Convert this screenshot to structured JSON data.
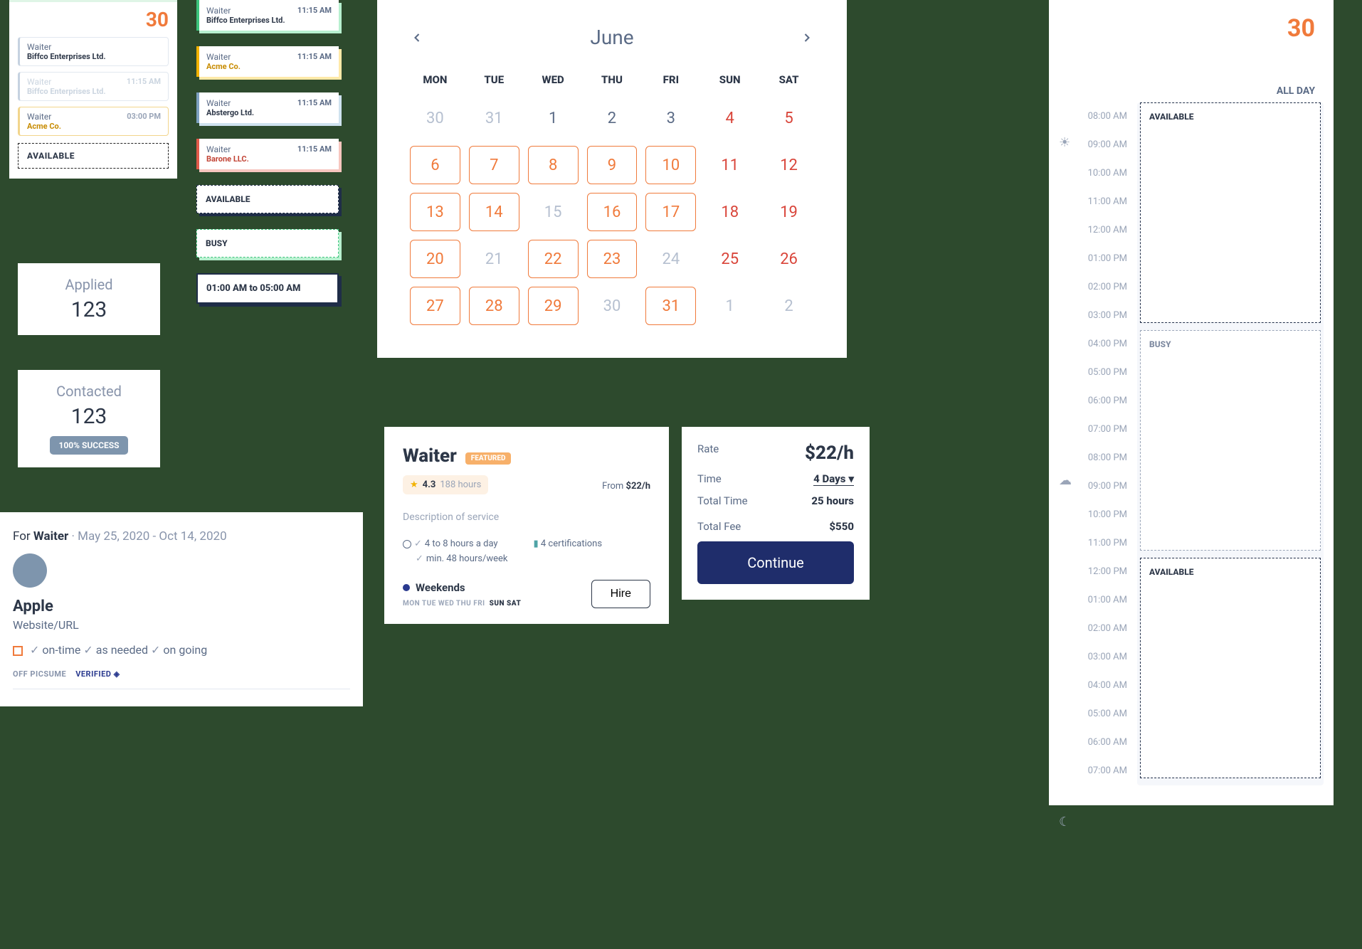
{
  "day30": {
    "num": "30",
    "slots": [
      {
        "role": "Waiter",
        "co": "Biffco Enterprises Ltd.",
        "time": ""
      },
      {
        "role": "Waiter",
        "co": "Biffco Enterprises Ltd.",
        "time": "11:15 AM"
      },
      {
        "role": "Waiter",
        "co": "Acme Co.",
        "time": "03:00 PM"
      }
    ],
    "avail": "AVAILABLE"
  },
  "slotcol": [
    {
      "role": "Waiter",
      "co": "Biffco Enterprises Ltd.",
      "time": "11:15 AM",
      "variant": "green"
    },
    {
      "role": "Waiter",
      "co": "Acme Co.",
      "time": "11:15 AM",
      "variant": "yellow"
    },
    {
      "role": "Waiter",
      "co": "Abstergo Ltd.",
      "time": "11:15 AM",
      "variant": "blue"
    },
    {
      "role": "Waiter",
      "co": "Barone LLC.",
      "time": "11:15 AM",
      "variant": "red"
    }
  ],
  "dash_available": "AVAILABLE",
  "dash_busy": "BUSY",
  "timebox": "01:00 AM to 05:00 AM",
  "kpi1": {
    "label": "Applied",
    "num": "123"
  },
  "kpi2": {
    "label": "Contacted",
    "num": "123",
    "badge": "100% SUCCESS"
  },
  "profile": {
    "for": "For ",
    "role": "Waiter",
    "sep": "   ·   ",
    "range": "May 25, 2020 - Oct 14, 2020",
    "name": "Apple",
    "url": "Website/URL",
    "tags": [
      "on-time",
      "as needed",
      "on going"
    ],
    "off": "OFF PICSUME",
    "ver": "VERIFIED"
  },
  "calendar": {
    "month": "June",
    "dow": [
      "MON",
      "TUE",
      "WED",
      "THU",
      "FRI",
      "SUN",
      "SAT"
    ],
    "cells": [
      [
        "30",
        "dim"
      ],
      [
        "31",
        "dim"
      ],
      [
        "1",
        "norm"
      ],
      [
        "2",
        "norm"
      ],
      [
        "3",
        "norm"
      ],
      [
        "4",
        "red"
      ],
      [
        "5",
        "red"
      ],
      [
        "6",
        "hl"
      ],
      [
        "7",
        "hl"
      ],
      [
        "8",
        "hl"
      ],
      [
        "9",
        "hl"
      ],
      [
        "10",
        "hl"
      ],
      [
        "11",
        "red"
      ],
      [
        "12",
        "red"
      ],
      [
        "13",
        "hl"
      ],
      [
        "14",
        "hl"
      ],
      [
        "15",
        "dim"
      ],
      [
        "16",
        "hl"
      ],
      [
        "17",
        "hl"
      ],
      [
        "18",
        "red"
      ],
      [
        "19",
        "red"
      ],
      [
        "20",
        "hl"
      ],
      [
        "21",
        "dim"
      ],
      [
        "22",
        "hl"
      ],
      [
        "23",
        "hl"
      ],
      [
        "24",
        "dim"
      ],
      [
        "25",
        "red"
      ],
      [
        "26",
        "red"
      ],
      [
        "27",
        "hl"
      ],
      [
        "28",
        "hl"
      ],
      [
        "29",
        "hl"
      ],
      [
        "30",
        "dim"
      ],
      [
        "31",
        "hl"
      ],
      [
        "1",
        "dim"
      ],
      [
        "2",
        "dim"
      ]
    ]
  },
  "svc": {
    "title": "Waiter",
    "featured": "FEATURED",
    "rating": "4.3",
    "hours": "188 hours",
    "from_label": "From ",
    "from_price": "$22/h",
    "desc": "Description of service",
    "m1": "4 to 8 hours a day",
    "m2": "min. 48 hours/week",
    "m3": "4 certifications",
    "weekends": "Weekends",
    "dow_mini_dim": "MON  TUE  WED THU   FRI",
    "dow_mini_bold": "SUN   SAT",
    "hire": "Hire"
  },
  "rate": {
    "l_rate": "Rate",
    "v_rate": "$22/h",
    "l_time": "Time",
    "v_time": "4 Days",
    "l_total_time": "Total Time",
    "v_total_time": "25 hours",
    "l_total_fee": "Total Fee",
    "v_total_fee": "$550",
    "continue": "Continue"
  },
  "dayview": {
    "num": "30",
    "allday": "ALL DAY",
    "times": [
      "08:00 AM",
      "09:00 AM",
      "10:00 AM",
      "11:00 AM",
      "12:00 AM",
      "01:00 PM",
      "02:00 PM",
      "03:00 PM",
      "04:00 PM",
      "05:00 PM",
      "06:00 PM",
      "07:00 PM",
      "08:00 PM",
      "09:00 PM",
      "10:00 PM",
      "11:00 PM",
      "12:00 PM",
      "01:00 AM",
      "02:00 AM",
      "03:00 AM",
      "04:00 AM",
      "05:00 AM",
      "06:00 AM",
      "07:00 AM"
    ],
    "b_avail": "AVAILABLE",
    "b_busy": "BUSY",
    "b_avail2": "AVAILABLE"
  }
}
